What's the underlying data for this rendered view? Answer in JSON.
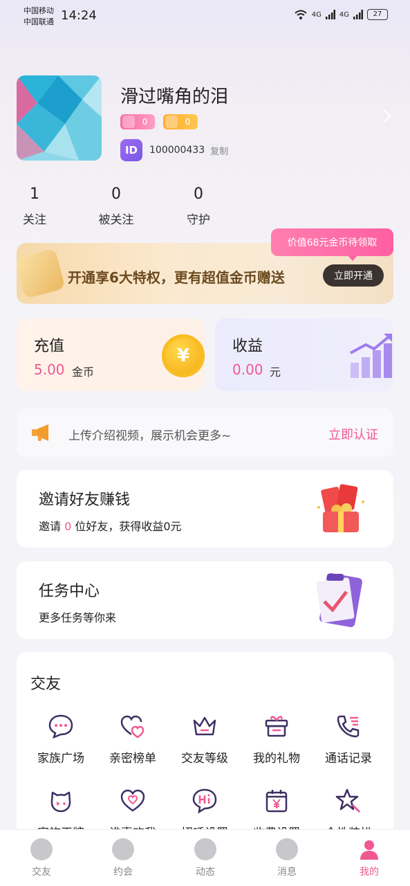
{
  "status_bar": {
    "carrier1": "中国移动",
    "carrier2": "中国联通",
    "time": "14:24",
    "signal1": "4G",
    "signal2": "4G",
    "battery": "27"
  },
  "profile": {
    "nickname": "滑过嘴角的泪",
    "badge_charm": "0",
    "badge_wealth": "0",
    "id_tag": "ID",
    "id_number": "100000433",
    "copy_label": "复制"
  },
  "stats": [
    {
      "value": "1",
      "label": "关注"
    },
    {
      "value": "0",
      "label": "被关注"
    },
    {
      "value": "0",
      "label": "守护"
    }
  ],
  "vip": {
    "bubble": "价值68元金币待领取",
    "text": "开通享6大特权，更有超值金币赠送",
    "button": "立即开通"
  },
  "wallet": {
    "recharge_title": "充值",
    "recharge_amount": "5.00",
    "recharge_unit": "金币",
    "coin_symbol": "¥",
    "income_title": "收益",
    "income_amount": "0.00",
    "income_unit": "元"
  },
  "notice": {
    "message": "上传介绍视频，展示机会更多~",
    "link": "立即认证"
  },
  "invite": {
    "title": "邀请好友赚钱",
    "sub_prefix": "邀请 ",
    "count": "0",
    "sub_suffix": " 位好友，获得收益0元"
  },
  "task": {
    "title": "任务中心",
    "sub": "更多任务等你来"
  },
  "friends": {
    "title": "交友",
    "items": [
      {
        "label": "家族广场",
        "icon": "chat-bubble-icon"
      },
      {
        "label": "亲密榜单",
        "icon": "hearts-icon"
      },
      {
        "label": "交友等级",
        "icon": "crown-icon"
      },
      {
        "label": "我的礼物",
        "icon": "gift-box-icon"
      },
      {
        "label": "通话记录",
        "icon": "phone-log-icon"
      },
      {
        "label": "家族王牌",
        "icon": "cat-face-icon"
      },
      {
        "label": "谁喜欢我",
        "icon": "heart-outline-icon"
      },
      {
        "label": "招呼设置",
        "icon": "hi-bubble-icon"
      },
      {
        "label": "收费设置",
        "icon": "yen-tag-icon"
      },
      {
        "label": "个性装扮",
        "icon": "star-wand-icon"
      }
    ]
  },
  "tabbar": [
    {
      "label": "交友",
      "active": false
    },
    {
      "label": "约会",
      "active": false
    },
    {
      "label": "动态",
      "active": false
    },
    {
      "label": "消息",
      "active": false
    },
    {
      "label": "我的",
      "active": true
    }
  ],
  "colors": {
    "accent_pink": "#f05891",
    "vip_dark": "#3b3330",
    "icon_purple": "#3d2f63"
  }
}
